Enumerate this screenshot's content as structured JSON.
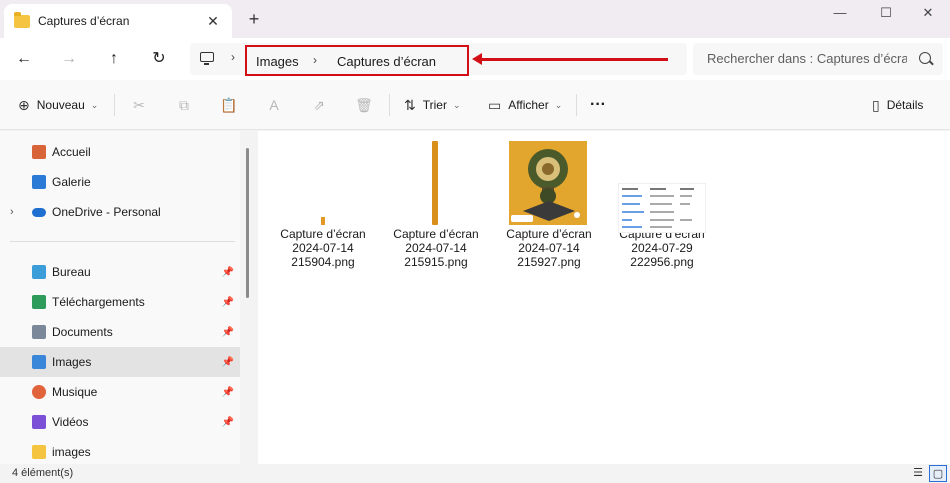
{
  "window": {
    "tab_title": "Captures d’écran",
    "tab_close": "✕",
    "new_tab": "+",
    "min": "—",
    "max": "☐",
    "close": "✕"
  },
  "nav": {
    "back": "←",
    "forward": "→",
    "up": "↑",
    "refresh": "↻",
    "chevron": "›"
  },
  "breadcrumb": [
    "Images",
    "Captures d’écran"
  ],
  "search": {
    "placeholder": "Rechercher dans : Captures d’écran"
  },
  "toolbar": {
    "new_label": "Nouveau",
    "new_icon": "⊕",
    "sort_label": "Trier",
    "sort_icon": "⇅",
    "view_label": "Afficher",
    "view_icon": "▭",
    "chevron": "⌄",
    "more": "···",
    "details_label": "Détails",
    "details_icon": "▯",
    "cut_icon": "✂",
    "copy_icon": "⧉",
    "paste_icon": "📋",
    "rename_icon": "A",
    "share_icon": "⇗",
    "delete_icon": "🗑"
  },
  "sidebar": {
    "items": [
      {
        "label": "Accueil",
        "icon": "home-icon",
        "color": "#d9643a",
        "pinned": false
      },
      {
        "label": "Galerie",
        "icon": "gallery-icon",
        "color": "#2b7bd6",
        "pinned": false
      },
      {
        "label": "OneDrive - Personal",
        "icon": "cloud-icon",
        "color": "#1f6fd1",
        "pinned": false,
        "expandable": true
      },
      {
        "label": "Bureau",
        "icon": "desktop-icon",
        "color": "#3b9ed9",
        "pinned": true
      },
      {
        "label": "Téléchargements",
        "icon": "download-icon",
        "color": "#2e9b5a",
        "pinned": true
      },
      {
        "label": "Documents",
        "icon": "documents-icon",
        "color": "#7a8899",
        "pinned": true
      },
      {
        "label": "Images",
        "icon": "pictures-icon",
        "color": "#3a86d8",
        "pinned": true,
        "selected": true
      },
      {
        "label": "Musique",
        "icon": "music-icon",
        "color": "#e0633b",
        "pinned": true
      },
      {
        "label": "Vidéos",
        "icon": "videos-icon",
        "color": "#7b4fd6",
        "pinned": true
      },
      {
        "label": "images",
        "icon": "folder-icon",
        "color": "#f5c541",
        "pinned": false
      }
    ],
    "pin_glyph": "📌",
    "expander": "›"
  },
  "files": [
    {
      "line1": "Capture d’écran",
      "line2": "2024-07-14",
      "line3": "215904.png",
      "thumb": "tiny-orange"
    },
    {
      "line1": "Capture d’écran",
      "line2": "2024-07-14",
      "line3": "215915.png",
      "thumb": "tall-orange"
    },
    {
      "line1": "Capture d’écran",
      "line2": "2024-07-14",
      "line3": "215927.png",
      "thumb": "artwork"
    },
    {
      "line1": "Capture d’écran",
      "line2": "2024-07-29",
      "line3": "222956.png",
      "thumb": "table"
    }
  ],
  "status": {
    "count": "4 élément(s)",
    "list_view": "☰",
    "tile_view": "▢"
  },
  "colors": {
    "accent": "#2a6fd6",
    "highlight": "#d20f16",
    "folder": "#f5c541"
  }
}
